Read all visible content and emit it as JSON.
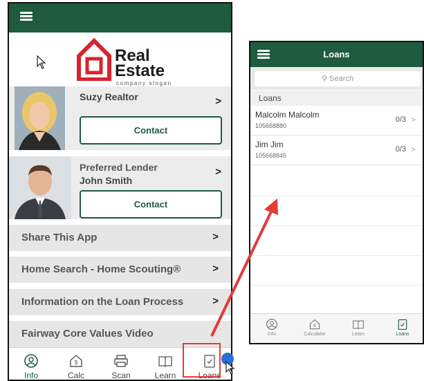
{
  "left_app": {
    "logo": {
      "line1": "Real",
      "line2": "Estate",
      "slogan": "company slogan"
    },
    "agent": {
      "name": "Suzy Realtor",
      "contact_label": "Contact"
    },
    "lender": {
      "role": "Preferred Lender",
      "name": "John Smith",
      "contact_label": "Contact"
    },
    "menu": [
      {
        "label": "Share This App"
      },
      {
        "label": "Home Search - Home Scouting®"
      },
      {
        "label": "Information on the Loan Process"
      },
      {
        "label": "Fairway Core Values Video"
      }
    ],
    "tabs": [
      {
        "label": "Info",
        "icon": "info-icon"
      },
      {
        "label": "Calc",
        "icon": "calculator-icon"
      },
      {
        "label": "Scan",
        "icon": "scan-icon"
      },
      {
        "label": "Learn",
        "icon": "book-icon"
      },
      {
        "label": "Loans",
        "icon": "checklist-icon"
      }
    ],
    "active_tab": "Info"
  },
  "right_app": {
    "title": "Loans",
    "search_placeholder": "Search",
    "section_header": "Loans",
    "loans": [
      {
        "name": "Malcolm Malcolm",
        "id": "105668880",
        "count": "0/3"
      },
      {
        "name": "Jim Jim",
        "id": "105668845",
        "count": "0/3"
      }
    ],
    "tabs": [
      {
        "label": "Info",
        "icon": "info-icon"
      },
      {
        "label": "Calculator",
        "icon": "calculator-icon"
      },
      {
        "label": "Learn",
        "icon": "book-icon"
      },
      {
        "label": "Loans",
        "icon": "checklist-icon"
      }
    ],
    "active_tab": "Loans"
  },
  "colors": {
    "brand_green": "#1f5b3e",
    "logo_red": "#d9232e",
    "arrow_red": "#e33a3a"
  }
}
